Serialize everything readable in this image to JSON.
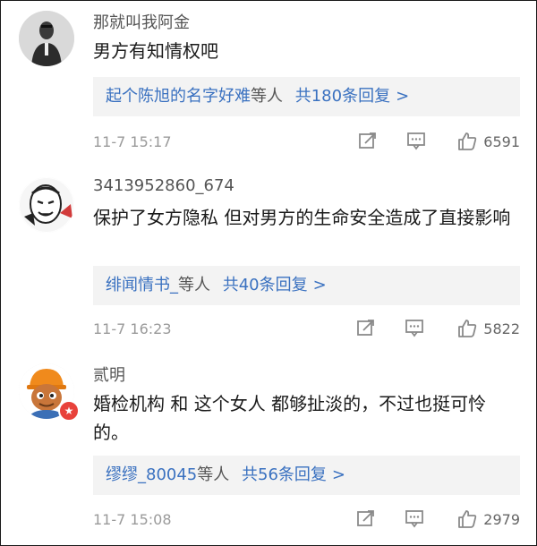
{
  "comments": [
    {
      "username": "那就叫我阿金",
      "text": "男方有知情权吧",
      "reply": {
        "repliers": "起个陈旭的名字好难",
        "suffix": "等人",
        "count": "共180条回复",
        "chevron": ">"
      },
      "time": "11-7 15:17",
      "likes": "6591",
      "avatar_icon": "figure-avatar-icon"
    },
    {
      "username": "3413952860_674",
      "text": "保护了女方隐私  但对男方的生命安全造成了直接影响",
      "reply": {
        "repliers": "绯闻情书_",
        "suffix": "等人",
        "count": "共40条回复",
        "chevron": ">"
      },
      "time": "11-7 16:23",
      "likes": "5822",
      "avatar_icon": "meme-face-avatar-icon"
    },
    {
      "username": "贰明",
      "text": "婚检机构 和 这个女人 都够扯淡的，不过也挺可怜的。",
      "reply": {
        "repliers": "缪缪_80045",
        "suffix": "等人",
        "count": "共56条回复",
        "chevron": ">"
      },
      "time": "11-7 15:08",
      "likes": "2979",
      "avatar_icon": "cartoon-worker-avatar-icon"
    }
  ],
  "icons": {
    "share": "share-icon",
    "comment": "comment-icon",
    "like": "thumbs-up-icon"
  },
  "colors": {
    "link": "#3a71c0",
    "meta": "#9a9a9a",
    "reply_bg": "#f3f3f3"
  }
}
